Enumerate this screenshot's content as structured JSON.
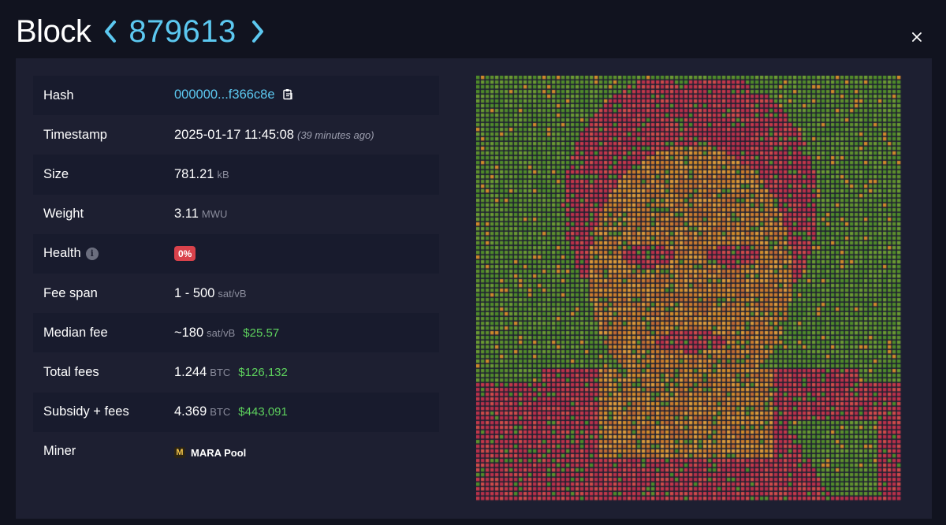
{
  "header": {
    "title": "Block",
    "height": "879613"
  },
  "details": {
    "rows": [
      {
        "label": "Hash",
        "value": "000000...f366c8e"
      },
      {
        "label": "Timestamp",
        "value": "2025-01-17 11:45:08",
        "note": "(39 minutes ago)"
      },
      {
        "label": "Size",
        "value": "781.21",
        "unit": "kB"
      },
      {
        "label": "Weight",
        "value": "3.11",
        "unit": "MWU"
      },
      {
        "label": "Health",
        "badge": "0%"
      },
      {
        "label": "Fee span",
        "value": "1 - 500",
        "unit": "sat/vB"
      },
      {
        "label": "Median fee",
        "value": "~180",
        "unit": "sat/vB",
        "fiat": "$25.57"
      },
      {
        "label": "Total fees",
        "value": "1.244",
        "unit": "BTC",
        "fiat": "$126,132"
      },
      {
        "label": "Subsidy + fees",
        "value": "4.369",
        "unit": "BTC",
        "fiat": "$443,091"
      },
      {
        "label": "Miner",
        "miner_logo": "M",
        "miner": "MARA Pool"
      }
    ]
  },
  "icons": {
    "prev": "chevron-left-icon",
    "next": "chevron-right-icon",
    "close": "close-icon",
    "copy": "clipboard-icon",
    "info": "info-icon"
  },
  "colors": {
    "accent": "#5cc8f0",
    "fiat": "#5dd15d",
    "badge_bad": "#d9424b",
    "fee_low": "#5d8f2d",
    "fee_mid": "#d08a2a",
    "fee_high": "#c4374a"
  }
}
